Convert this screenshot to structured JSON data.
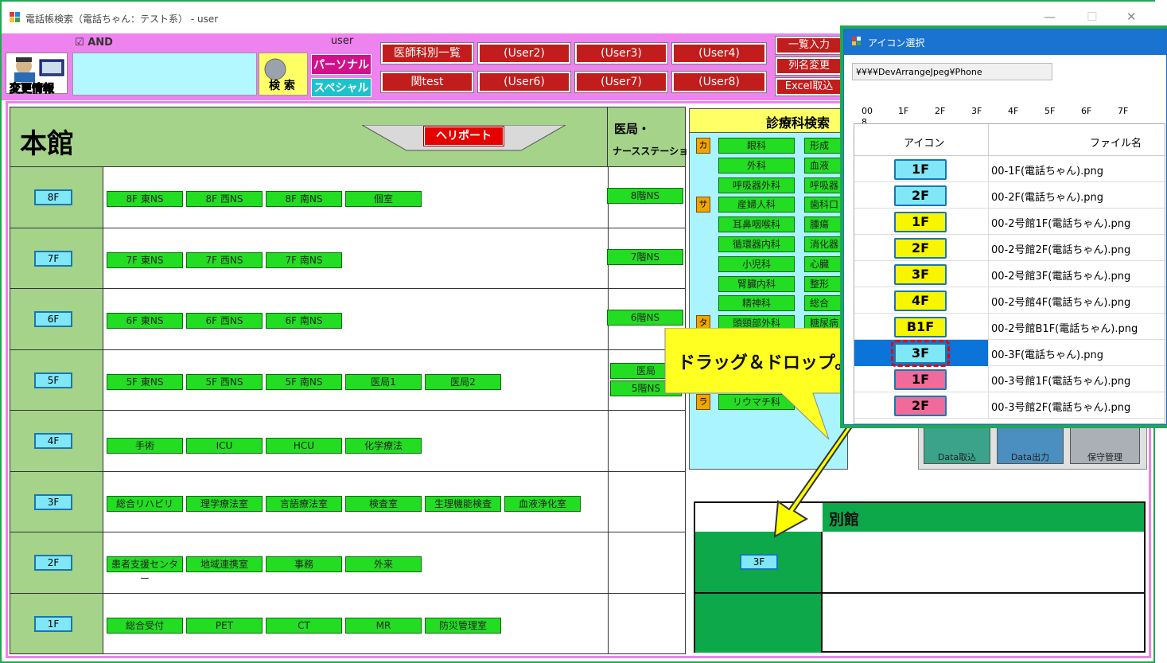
{
  "window": {
    "title": "電話帳検索（電話ちゃん：テスト系） - user"
  },
  "toolbar": {
    "and_label": "AND",
    "user_label": "user",
    "change_info_label": "変更情報",
    "search_label": "検 索",
    "personal_label": "パーソナル",
    "special_label": "スペシャル",
    "red_row1": [
      "医師科別一覧",
      "(User2)",
      "(User3)",
      "(User4)"
    ],
    "red_row2": [
      "関test",
      "(User6)",
      "(User7)",
      "(User8)"
    ],
    "right_buttons": [
      "一覧入力",
      "列名変更",
      "Excel取込"
    ]
  },
  "main": {
    "building": "本館",
    "heli": "ヘリポート",
    "ns_header_1": "医局・",
    "ns_header_2": "ナースステーション",
    "floors": [
      {
        "label": "8F",
        "depts": [
          "8F 東NS",
          "8F 西NS",
          "8F 南NS",
          "個室"
        ],
        "ns": [
          "8階NS"
        ]
      },
      {
        "label": "7F",
        "depts": [
          "7F 東NS",
          "7F 西NS",
          "7F 南NS"
        ],
        "ns": [
          "7階NS"
        ]
      },
      {
        "label": "6F",
        "depts": [
          "6F 東NS",
          "6F 西NS",
          "6F 南NS"
        ],
        "ns": [
          "6階NS"
        ]
      },
      {
        "label": "5F",
        "depts": [
          "5F 東NS",
          "5F 西NS",
          "5F 南NS",
          "医局1",
          "医局2"
        ],
        "ns": [
          "医局",
          "5階NS"
        ]
      },
      {
        "label": "4F",
        "depts": [
          "手術",
          "ICU",
          "HCU",
          "化学療法"
        ],
        "ns": []
      },
      {
        "label": "3F",
        "depts": [
          "総合リハビリ",
          "理学療法室",
          "言語療法室",
          "検査室",
          "生理機能検査",
          "血液浄化室"
        ],
        "ns": []
      },
      {
        "label": "2F",
        "depts": [
          "患者支援センター",
          "地域連携室",
          "事務",
          "外来"
        ],
        "ns": []
      },
      {
        "label": "1F",
        "depts": [
          "総合受付",
          "PET",
          "CT",
          "MR",
          "防災管理室"
        ],
        "ns": []
      }
    ]
  },
  "clinic": {
    "header": "診療科検索",
    "kana": [
      "カ",
      "サ",
      "タ",
      "マ",
      "ラ"
    ],
    "col1": [
      "眼科",
      "外科",
      "呼吸器外科",
      "産婦人科",
      "耳鼻咽喉科",
      "循環器内科",
      "小児科",
      "腎臓内科",
      "精神科",
      "頭頸部外科",
      "",
      "放射線科",
      "麻酔科",
      "リウマチ科"
    ],
    "col2": [
      "形成",
      "血液",
      "呼吸器",
      "歯科口",
      "腫瘍",
      "消化器",
      "心臓",
      "整形",
      "総合",
      "糖尿病"
    ]
  },
  "annex": {
    "title": "別館",
    "floor_btn": "3F"
  },
  "bottom_tools": [
    "Data取込",
    "Data出力",
    "保守管理"
  ],
  "callout": {
    "text": "ドラッグ＆ドロップ。"
  },
  "dialog": {
    "title": "アイコン選択",
    "path": "¥¥¥¥DevArrangeJpeg¥Phone",
    "tabs": [
      "00",
      "1F",
      "2F",
      "3F",
      "4F",
      "5F",
      "6F",
      "7F",
      "8"
    ],
    "col_icon": "アイコン",
    "col_file": "ファイル名",
    "rows": [
      {
        "label": "1F",
        "file": "00-1F(電話ちゃん).png",
        "color": "#7fe7f5"
      },
      {
        "label": "2F",
        "file": "00-2F(電話ちゃん).png",
        "color": "#7fe7f5"
      },
      {
        "label": "1F",
        "file": "00-2号館1F(電話ちゃん).png",
        "color": "#f7f500"
      },
      {
        "label": "2F",
        "file": "00-2号館2F(電話ちゃん).png",
        "color": "#f7f500"
      },
      {
        "label": "3F",
        "file": "00-2号館3F(電話ちゃん).png",
        "color": "#f7f500"
      },
      {
        "label": "4F",
        "file": "00-2号館4F(電話ちゃん).png",
        "color": "#f7f500"
      },
      {
        "label": "B1F",
        "file": "00-2号館B1F(電話ちゃん).png",
        "color": "#f7f500"
      },
      {
        "label": "3F",
        "file": "00-3F(電話ちゃん).png",
        "color": "#7fe7f5"
      },
      {
        "label": "1F",
        "file": "00-3号館1F(電話ちゃん).png",
        "color": "#f06a9a"
      },
      {
        "label": "2F",
        "file": "00-3号館2F(電話ちゃん).png",
        "color": "#f06a9a"
      }
    ]
  }
}
